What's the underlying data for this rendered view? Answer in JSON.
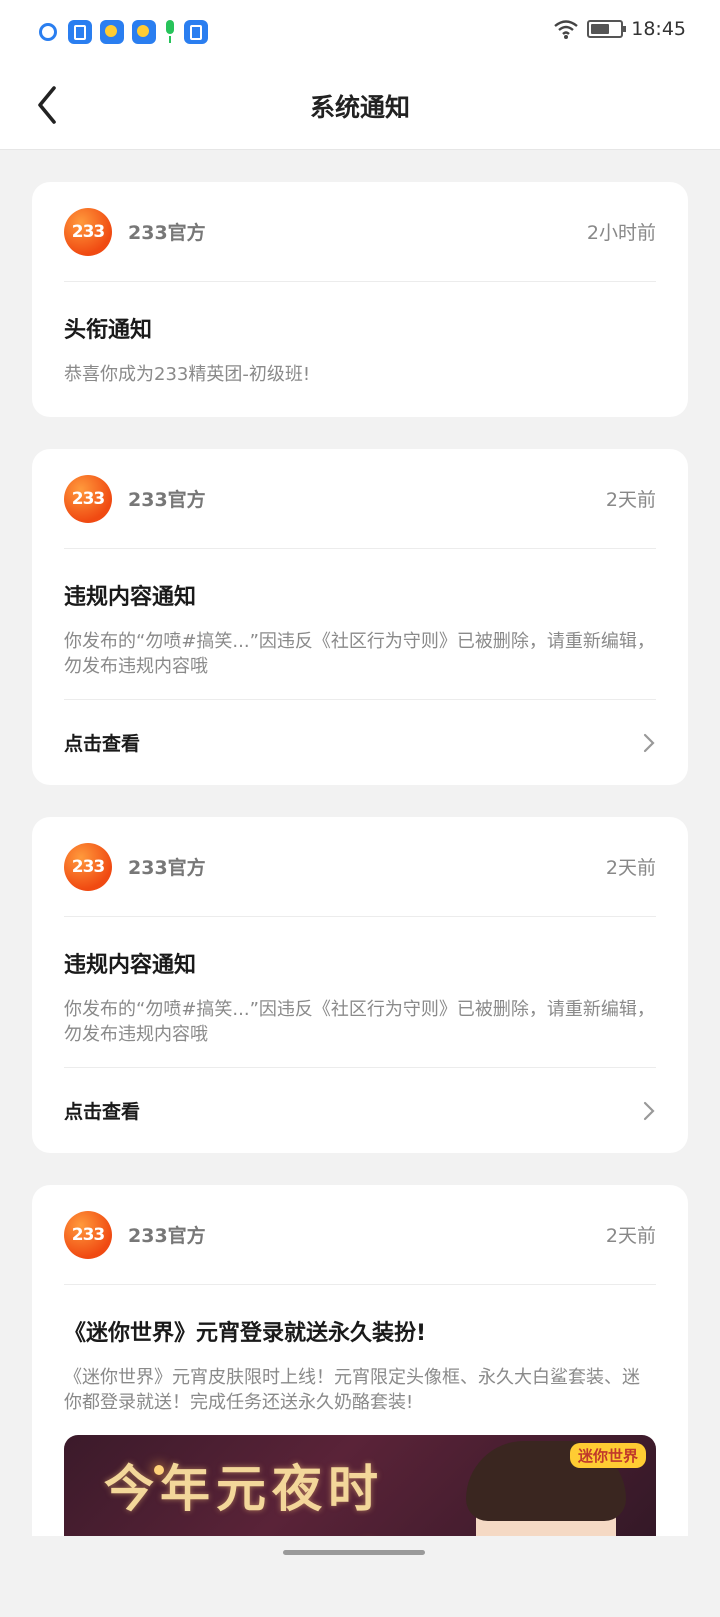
{
  "status_bar": {
    "time": "18:45",
    "icons": [
      "search-icon",
      "shield-icon",
      "weather-icon",
      "weather-icon",
      "microphone-icon",
      "shield-icon"
    ],
    "battery_level": 0.65
  },
  "header": {
    "title": "系统通知",
    "back_icon": "chevron-left-icon"
  },
  "notifications": [
    {
      "logo": "233",
      "sender": "233官方",
      "time": "2小时前",
      "title": "头衔通知",
      "text": "恭喜你成为233精英团-初级班!"
    },
    {
      "logo": "233",
      "sender": "233官方",
      "time": "2天前",
      "title": "违规内容通知",
      "text": "你发布的“勿喷#搞笑...”因违反《社区行为守则》已被删除，请重新编辑，勿发布违规内容哦",
      "action": "点击查看"
    },
    {
      "logo": "233",
      "sender": "233官方",
      "time": "2天前",
      "title": "违规内容通知",
      "text": "你发布的“勿喷#搞笑...”因违反《社区行为守则》已被删除，请重新编辑，勿发布违规内容哦",
      "action": "点击查看"
    },
    {
      "logo": "233",
      "sender": "233官方",
      "time": "2天前",
      "title": "《迷你世界》元宵登录就送永久装扮!",
      "text": "《迷你世界》元宵皮肤限时上线！元宵限定头像框、永久大白鲨套装、迷你都登录就送！完成任务还送永久奶酪套装!",
      "banner_text": "今年元夜时",
      "banner_logo": "迷你世界"
    }
  ],
  "colors": {
    "background": "#f2f2f2",
    "card": "#ffffff",
    "logo_orange": "#f04a12"
  }
}
